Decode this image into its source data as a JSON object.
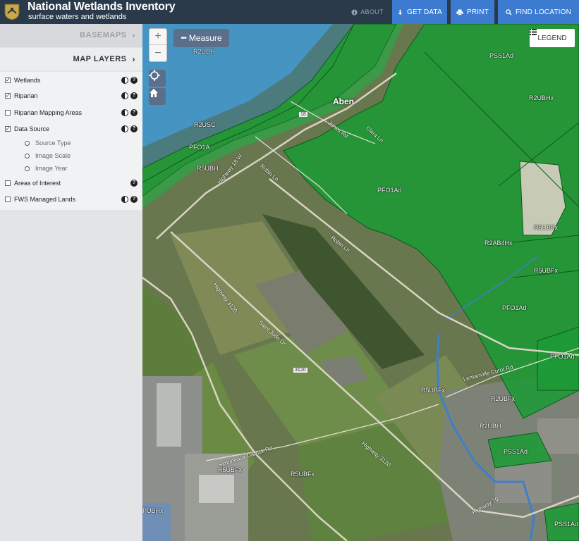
{
  "header": {
    "title": "National Wetlands Inventory",
    "subtitle": "surface waters and wetlands",
    "logo_icon": "fws-shield-icon",
    "nav": {
      "about": "ABOUT",
      "get_data": "GET DATA",
      "print": "PRINT",
      "find_location": "FIND LOCATION"
    }
  },
  "sidebar": {
    "basemaps": "BASEMAPS",
    "map_layers": "MAP LAYERS",
    "layers": [
      {
        "label": "Wetlands",
        "checked": true
      },
      {
        "label": "Riparian",
        "checked": true
      },
      {
        "label": "Riparian Mapping Areas",
        "checked": false
      },
      {
        "label": "Data Source",
        "checked": true
      },
      {
        "label": "Areas of Interest",
        "checked": false
      },
      {
        "label": "FWS Managed Lands",
        "checked": false
      }
    ],
    "data_source_options": [
      "Source Type",
      "Image Scale",
      "Image Year"
    ]
  },
  "map": {
    "controls": {
      "zoom_in": "+",
      "zoom_out": "−",
      "measure": "Measure",
      "legend": "LEGEND"
    },
    "place": "Aben",
    "wetland_labels": {
      "r2ubh": "R2UBH",
      "pss1ad_ne": "PSS1Ad",
      "r2ubhx": "R2UBHx",
      "r2usc": "R2USC",
      "pfo1a": "PFO1A",
      "r5ubh": "R5UBH",
      "pfo1ad_center": "PFO1Ad",
      "r5ubfx_pond": "R5UBFx",
      "r2ab4hx": "R2AB4Hx",
      "r5ubfx_east": "R5UBFx",
      "pfo1ad_east": "PFO1Ad",
      "pfo1ad_far": "PFO1Ad",
      "r5ubfx_ditch": "R5UBFx",
      "r2ubfx": "R2UBFx",
      "r2ubh_south": "R2UBH",
      "pss1ad_south": "PSS1Ad",
      "r5ubfx_sw": "R5UBFx",
      "r5ubfx_field": "R5UBFx",
      "pubhx": "PUBHx",
      "pss1ad_corner": "PSS1Ad"
    },
    "roads": {
      "hwy18": "Highway 18 W",
      "route18": "18",
      "jones": "Jones Rd",
      "clara": "Clara Ln",
      "robin_w": "Robin Ln",
      "robin_e": "Robin Ln",
      "hwy3120_a": "Highway 3120",
      "saint_jude": "Saint Jude Dr",
      "route3120": "3120",
      "lemanville": "Lemanville Curot Rd",
      "simoneaux": "Simoneaux Darrick Rd",
      "hwy3120_b": "Highway 3120",
      "hwy70": "Highway 70"
    }
  }
}
